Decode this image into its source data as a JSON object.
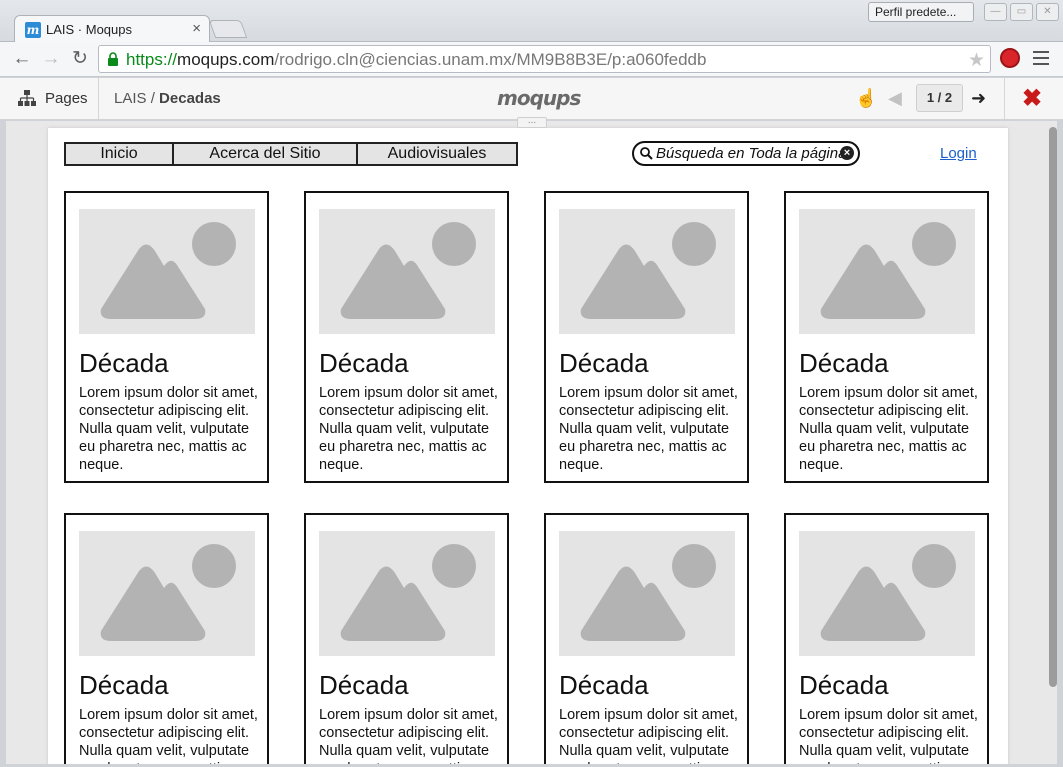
{
  "browser": {
    "tab_title": "LAIS · Moqups",
    "tab_close": "×",
    "favicon_letter": "m",
    "profile": "Perfil predete...",
    "url_scheme": "https://",
    "url_host": "moqups.com",
    "url_path": "/rodrigo.cln@ciencias.unam.mx/MM9B8B3E/p:a060feddb"
  },
  "moqups": {
    "pages_label": "Pages",
    "breadcrumb_project": "LAIS",
    "breadcrumb_sep": " / ",
    "breadcrumb_page": "Decadas",
    "logo": "moqups",
    "page_counter": "1 / 2",
    "grip": "..."
  },
  "site": {
    "nav": [
      "Inicio",
      "Acerca del Sitio",
      "Audiovisuales"
    ],
    "search_placeholder": "Búsqueda en Toda la página",
    "login": "Login",
    "cards": [
      {
        "title": "Década",
        "text": "Lorem ipsum dolor sit amet, consectetur adipiscing elit. Nulla quam velit, vulputate eu pharetra nec, mattis ac neque."
      },
      {
        "title": "Década",
        "text": "Lorem ipsum dolor sit amet, consectetur adipiscing elit. Nulla quam velit, vulputate eu pharetra nec, mattis ac neque."
      },
      {
        "title": "Década",
        "text": "Lorem ipsum dolor sit amet, consectetur adipiscing elit. Nulla quam velit, vulputate eu pharetra nec, mattis ac neque."
      },
      {
        "title": "Década",
        "text": "Lorem ipsum dolor sit amet, consectetur adipiscing elit. Nulla quam velit, vulputate eu pharetra nec, mattis ac neque."
      },
      {
        "title": "Década",
        "text": "Lorem ipsum dolor sit amet, consectetur adipiscing elit. Nulla quam velit, vulputate eu pharetra nec, mattis ac neque."
      },
      {
        "title": "Década",
        "text": "Lorem ipsum dolor sit amet, consectetur adipiscing elit. Nulla quam velit, vulputate eu pharetra nec, mattis ac neque."
      },
      {
        "title": "Década",
        "text": "Lorem ipsum dolor sit amet, consectetur adipiscing elit. Nulla quam velit, vulputate eu pharetra nec, mattis ac neque."
      },
      {
        "title": "Década",
        "text": "Lorem ipsum dolor sit amet, consectetur adipiscing elit. Nulla quam velit, vulputate eu pharetra nec, mattis ac neque."
      }
    ]
  },
  "colors": {
    "url_scheme": "#0a8a1a",
    "link": "#1a5fcc",
    "close": "#c91a1a",
    "placeholder_bg": "#e4e4e4",
    "placeholder_shape": "#b3b3b3"
  }
}
